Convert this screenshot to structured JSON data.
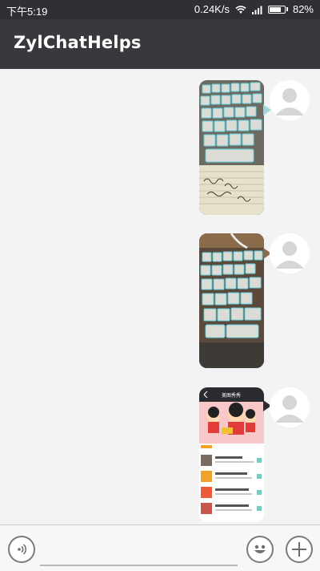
{
  "status_bar": {
    "time": "下午5:19",
    "network_speed": "0.24K/s",
    "battery_percent": "82%",
    "battery_level": 0.82
  },
  "app_bar": {
    "title": "ZylChatHelps"
  },
  "messages": [
    {
      "type": "image",
      "sender": "self",
      "image_content": "keyboard-photo"
    },
    {
      "type": "image",
      "sender": "self",
      "image_content": "keyboard-photo"
    },
    {
      "type": "image",
      "sender": "self",
      "image_content": "app-screenshot",
      "screenshot_header": "美图秀秀"
    }
  ],
  "input_bar": {
    "icons": [
      "voice-icon",
      "emoji-icon",
      "plus-icon"
    ]
  },
  "colors": {
    "status_bar_bg": "#2f3033",
    "app_bar_bg": "#38393c",
    "chat_bg": "#f3f3f3",
    "bubble_tail": "#9fd6d8"
  }
}
